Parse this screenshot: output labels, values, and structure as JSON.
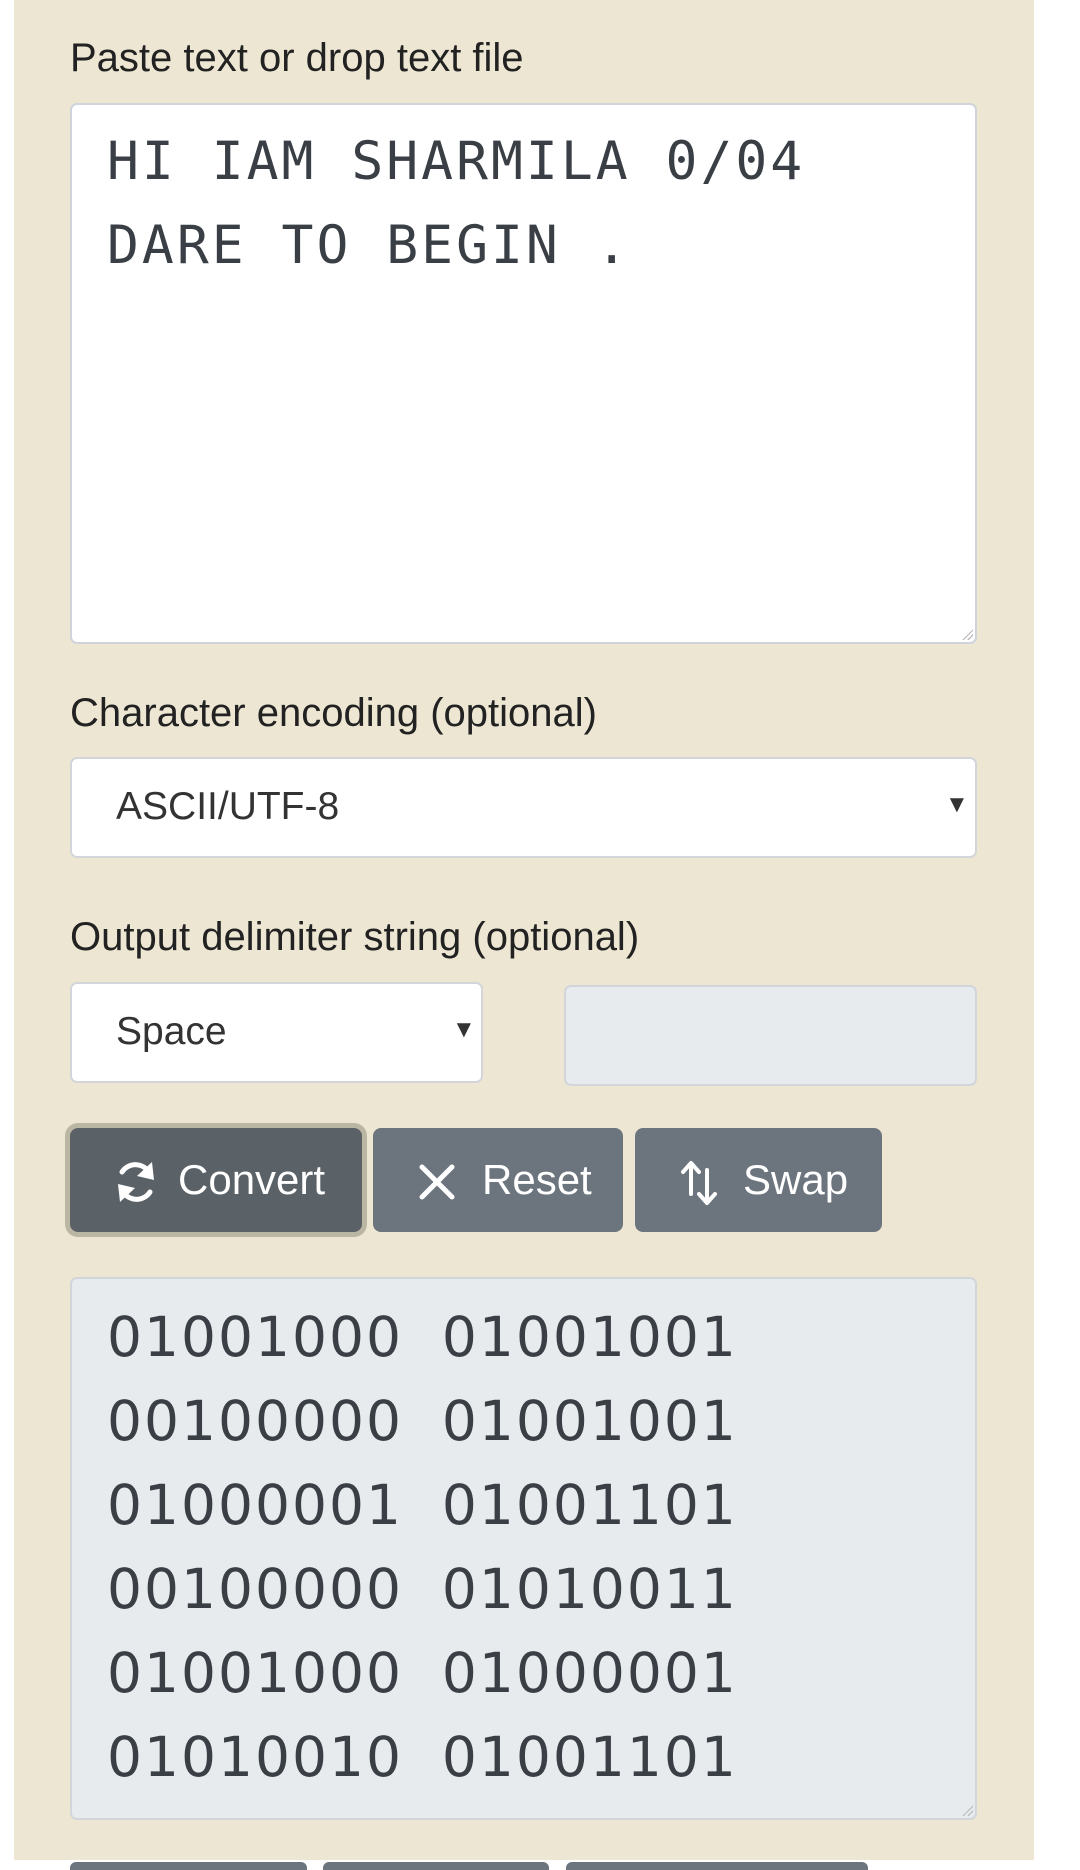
{
  "input_section": {
    "label": "Paste text or drop text file",
    "lines": [
      "HI IAM SHARMILA 0/04",
      "DARE TO BEGIN ."
    ]
  },
  "encoding_section": {
    "label": "Character encoding (optional)",
    "selected": "ASCII/UTF-8"
  },
  "delimiter_section": {
    "label": "Output delimiter string (optional)",
    "selected": "Space",
    "custom_value": ""
  },
  "buttons": {
    "convert": "Convert",
    "reset": "Reset",
    "swap": "Swap"
  },
  "output": {
    "lines": [
      "01001000  01001001",
      "00100000  01001001",
      "01000001  01001101",
      "00100000  01010011",
      "01001000  01000001",
      "01010010  01001101"
    ]
  },
  "icons": {
    "convert": "refresh-icon",
    "reset": "close-icon",
    "swap": "swap-vertical-icon",
    "dropdown": "caret-down-icon"
  },
  "colors": {
    "panel_background": "#ede6d3",
    "button": "#6c757d",
    "button_active": "#5a6268",
    "readonly_field": "#e8ebee"
  }
}
